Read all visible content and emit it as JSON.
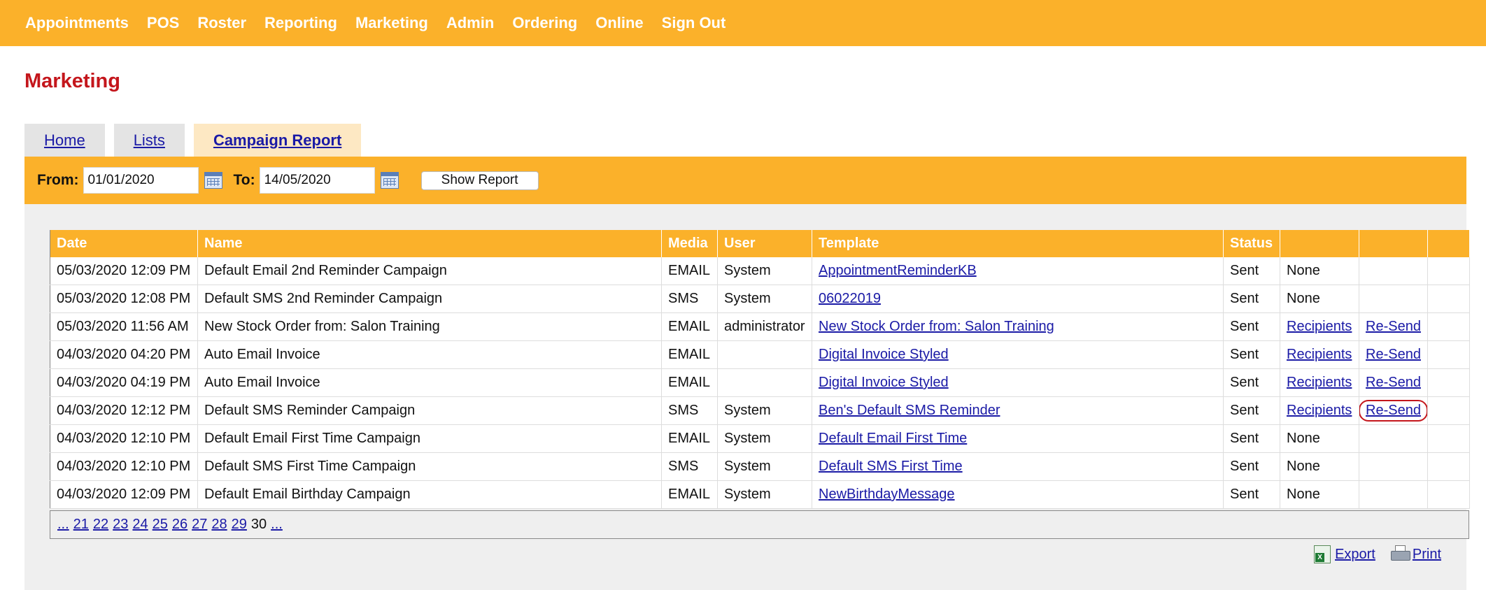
{
  "nav": {
    "items": [
      "Appointments",
      "POS",
      "Roster",
      "Reporting",
      "Marketing",
      "Admin",
      "Ordering",
      "Online",
      "Sign Out"
    ]
  },
  "page": {
    "title": "Marketing"
  },
  "tabs": [
    {
      "label": "Home",
      "active": false
    },
    {
      "label": "Lists",
      "active": false
    },
    {
      "label": "Campaign Report",
      "active": true
    }
  ],
  "filters": {
    "from_label": "From:",
    "from_value": "01/01/2020",
    "to_label": "To:",
    "to_value": "14/05/2020",
    "show_report_label": "Show Report"
  },
  "table": {
    "headers": [
      "Date",
      "Name",
      "Media",
      "User",
      "Template",
      "Status",
      "",
      "",
      ""
    ],
    "rows": [
      {
        "date": "05/03/2020 12:09 PM",
        "name": "Default Email 2nd Reminder Campaign",
        "media": "EMAIL",
        "user": "System",
        "template": "AppointmentReminderKB",
        "status": "Sent",
        "recipients": "None",
        "resend": ""
      },
      {
        "date": "05/03/2020 12:08 PM",
        "name": "Default SMS 2nd Reminder Campaign",
        "media": "SMS",
        "user": "System",
        "template": "06022019",
        "status": "Sent",
        "recipients": "None",
        "resend": ""
      },
      {
        "date": "05/03/2020 11:56 AM",
        "name": "New Stock Order from: Salon Training",
        "media": "EMAIL",
        "user": "administrator",
        "template": "New Stock Order from: Salon Training",
        "status": "Sent",
        "recipients": "Recipients",
        "resend": "Re-Send"
      },
      {
        "date": "04/03/2020 04:20 PM",
        "name": "Auto Email Invoice",
        "media": "EMAIL",
        "user": "",
        "template": "Digital Invoice Styled",
        "status": "Sent",
        "recipients": "Recipients",
        "resend": "Re-Send"
      },
      {
        "date": "04/03/2020 04:19 PM",
        "name": "Auto Email Invoice",
        "media": "EMAIL",
        "user": "",
        "template": "Digital Invoice Styled",
        "status": "Sent",
        "recipients": "Recipients",
        "resend": "Re-Send"
      },
      {
        "date": "04/03/2020 12:12 PM",
        "name": "Default SMS Reminder Campaign",
        "media": "SMS",
        "user": "System",
        "template": "Ben's Default SMS Reminder",
        "status": "Sent",
        "recipients": "Recipients",
        "resend": "Re-Send"
      },
      {
        "date": "04/03/2020 12:10 PM",
        "name": "Default Email First Time Campaign",
        "media": "EMAIL",
        "user": "System",
        "template": "Default Email First Time",
        "status": "Sent",
        "recipients": "None",
        "resend": ""
      },
      {
        "date": "04/03/2020 12:10 PM",
        "name": "Default SMS First Time Campaign",
        "media": "SMS",
        "user": "System",
        "template": "Default SMS First Time",
        "status": "Sent",
        "recipients": "None",
        "resend": ""
      },
      {
        "date": "04/03/2020 12:09 PM",
        "name": "Default Email Birthday Campaign",
        "media": "EMAIL",
        "user": "System",
        "template": "NewBirthdayMessage",
        "status": "Sent",
        "recipients": "None",
        "resend": ""
      }
    ]
  },
  "pager": {
    "items": [
      "...",
      "21",
      "22",
      "23",
      "24",
      "25",
      "26",
      "27",
      "28",
      "29",
      "30",
      "..."
    ],
    "current": "30"
  },
  "actions": {
    "export_label": "Export",
    "print_label": "Print"
  },
  "icons": {
    "calendar": "calendar-icon",
    "export": "excel-icon",
    "print": "printer-icon"
  },
  "colors": {
    "accent": "#fbb12a",
    "title_red": "#c4161c",
    "link": "#1a1aa6",
    "panel": "#efefef"
  }
}
